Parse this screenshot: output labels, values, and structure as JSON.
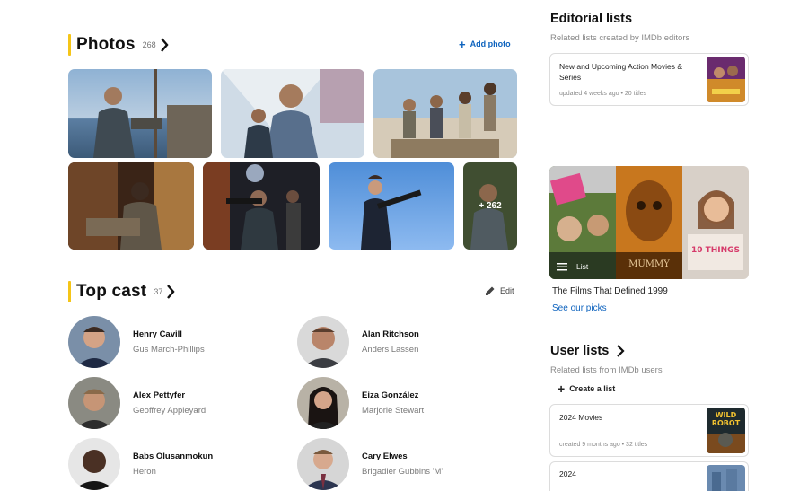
{
  "photos": {
    "title": "Photos",
    "count": "268",
    "add_label": "Add photo",
    "more_count": "+ 262"
  },
  "cast": {
    "title": "Top cast",
    "count": "37",
    "edit_label": "Edit",
    "members": [
      {
        "name": "Henry Cavill",
        "role": "Gus March-Phillips"
      },
      {
        "name": "Alan Ritchson",
        "role": "Anders Lassen"
      },
      {
        "name": "Alex Pettyfer",
        "role": "Geoffrey Appleyard"
      },
      {
        "name": "Eiza González",
        "role": "Marjorie Stewart"
      },
      {
        "name": "Babs Olusanmokun",
        "role": "Heron"
      },
      {
        "name": "Cary Elwes",
        "role": "Brigadier Gubbins 'M'"
      }
    ]
  },
  "editorial": {
    "title": "Editorial lists",
    "subtitle": "Related lists created by IMDb editors",
    "card": {
      "title": "New and Upcoming Action Movies & Series",
      "meta": "updated 4 weeks ago • 20 titles"
    },
    "feature": {
      "tag": "List",
      "title": "The Films That Defined 1999",
      "link": "See our picks"
    }
  },
  "user_lists": {
    "title": "User lists",
    "subtitle": "Related lists from IMDb users",
    "create_label": "Create a list",
    "cards": [
      {
        "title": "2024 Movies",
        "meta": "created 9 months ago • 32 titles",
        "thumb_text": "WILD ROBOT"
      },
      {
        "title": "2024",
        "meta": ""
      }
    ]
  },
  "icons": {
    "chevron": "chevron-right-icon",
    "plus": "plus-icon",
    "edit": "pencil-icon",
    "list": "list-icon"
  },
  "colors": {
    "accent": "#f5c518",
    "link": "#0e63be"
  }
}
